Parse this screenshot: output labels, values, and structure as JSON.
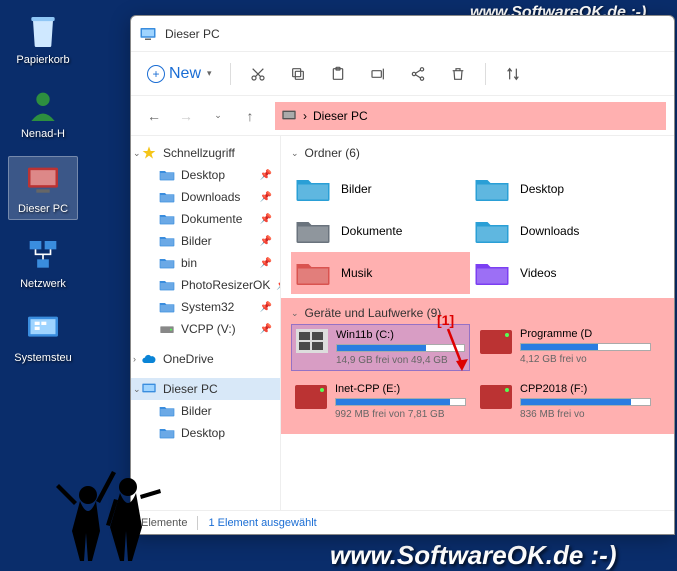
{
  "desktop_icons": [
    {
      "name": "papierkorb",
      "label": "Papierkorb"
    },
    {
      "name": "nenad-h",
      "label": "Nenad-H"
    },
    {
      "name": "dieser-pc",
      "label": "Dieser PC",
      "selected": true
    },
    {
      "name": "netzwerk",
      "label": "Netzwerk"
    },
    {
      "name": "systemsteu",
      "label": "Systemsteu"
    }
  ],
  "watermark_text": "www.SoftwareOK.de :-)",
  "annotation": "[1]",
  "window": {
    "title": "Dieser PC",
    "toolbar": {
      "new_label": "New"
    },
    "breadcrumb": {
      "label": "Dieser PC",
      "sep": "›"
    },
    "sidebar": {
      "quick": "Schnellzugriff",
      "items": [
        {
          "label": "Desktop",
          "pin": true
        },
        {
          "label": "Downloads",
          "pin": true
        },
        {
          "label": "Dokumente",
          "pin": true
        },
        {
          "label": "Bilder",
          "pin": true
        },
        {
          "label": "bin",
          "pin": true
        },
        {
          "label": "PhotoResizerOK",
          "pin": true
        },
        {
          "label": "System32",
          "pin": true
        },
        {
          "label": "VCPP (V:)",
          "pin": true
        }
      ],
      "onedrive": "OneDrive",
      "thispc": "Dieser PC",
      "pc_children": [
        {
          "label": "Bilder"
        },
        {
          "label": "Desktop"
        }
      ]
    },
    "folders_header": "Ordner (6)",
    "folders": [
      {
        "label": "Bilder",
        "color": "#2a9fd6"
      },
      {
        "label": "Desktop",
        "color": "#2a9fd6"
      },
      {
        "label": "Dokumente",
        "color": "#6a737d"
      },
      {
        "label": "Downloads",
        "color": "#2a9fd6"
      },
      {
        "label": "Musik",
        "color": "#d9534f",
        "hl": true
      },
      {
        "label": "Videos",
        "color": "#7b3ff2"
      }
    ],
    "drives_header": "Geräte und Laufwerke (9)",
    "drives": [
      {
        "name": "Win11b (C:)",
        "free": "14,9 GB frei von 49,4 GB",
        "fill": 70,
        "selected": true,
        "win": true
      },
      {
        "name": "Programme (D",
        "free": "4,12 GB frei vo",
        "fill": 60
      },
      {
        "name": "Inet-CPP (E:)",
        "free": "992 MB frei von 7,81 GB",
        "fill": 88
      },
      {
        "name": "CPP2018 (F:)",
        "free": "836 MB frei vo",
        "fill": 85
      }
    ],
    "status": {
      "elements": "Elemente",
      "selected": "1 Element ausgewählt"
    }
  }
}
